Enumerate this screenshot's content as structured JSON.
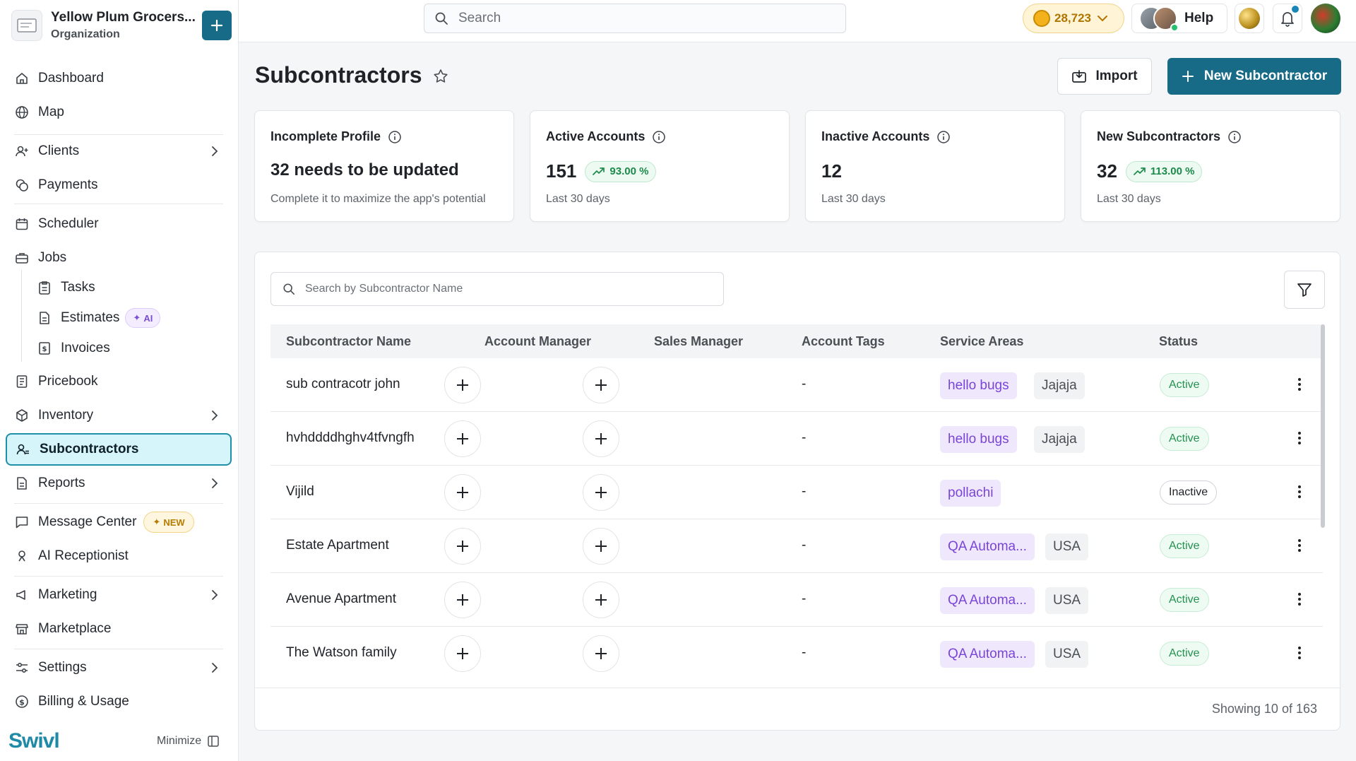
{
  "org": {
    "name": "Yellow Plum Grocers...",
    "subtitle": "Organization"
  },
  "sidebar": {
    "items": [
      {
        "label": "Dashboard"
      },
      {
        "label": "Map"
      },
      {
        "label": "Clients"
      },
      {
        "label": "Payments"
      },
      {
        "label": "Scheduler"
      },
      {
        "label": "Jobs"
      },
      {
        "label": "Tasks"
      },
      {
        "label": "Estimates",
        "badge": "AI"
      },
      {
        "label": "Invoices"
      },
      {
        "label": "Pricebook"
      },
      {
        "label": "Inventory"
      },
      {
        "label": "Subcontractors"
      },
      {
        "label": "Reports"
      },
      {
        "label": "Message Center",
        "badge": "NEW"
      },
      {
        "label": "AI Receptionist"
      },
      {
        "label": "Marketing"
      },
      {
        "label": "Marketplace"
      },
      {
        "label": "Settings"
      },
      {
        "label": "Billing & Usage"
      }
    ],
    "brand": "Swivl",
    "minimize_label": "Minimize"
  },
  "topbar": {
    "search_placeholder": "Search",
    "coins": "28,723",
    "help_label": "Help"
  },
  "page": {
    "title": "Subcontractors",
    "import_label": "Import",
    "new_label": "New Subcontractor"
  },
  "cards": [
    {
      "title": "Incomplete Profile",
      "value": "32 needs to be updated",
      "foot": "Complete it to maximize the app's potential"
    },
    {
      "title": "Active Accounts",
      "value": "151",
      "delta": "93.00 %",
      "foot": "Last 30 days"
    },
    {
      "title": "Inactive Accounts",
      "value": "12",
      "foot": "Last 30 days"
    },
    {
      "title": "New Subcontractors",
      "value": "32",
      "delta": "113.00 %",
      "foot": "Last 30 days"
    }
  ],
  "table": {
    "search_placeholder": "Search by Subcontractor Name",
    "columns": [
      "Subcontractor Name",
      "Account Manager",
      "Sales Manager",
      "Account Tags",
      "Service Areas",
      "Status"
    ],
    "rows": [
      {
        "name": "sub contracotr john",
        "tags": "-",
        "areas": [
          "hello bugs",
          "Jajaja"
        ],
        "status": "Active"
      },
      {
        "name": "hvhddddhghv4tfvngfh",
        "tags": "-",
        "areas": [
          "hello bugs",
          "Jajaja"
        ],
        "status": "Active"
      },
      {
        "name": "Vijild",
        "tags": "-",
        "areas": [
          "pollachi"
        ],
        "status": "Inactive"
      },
      {
        "name": "Estate Apartment",
        "tags": "-",
        "areas": [
          "QA Automa...",
          "USA"
        ],
        "status": "Active"
      },
      {
        "name": "Avenue Apartment",
        "tags": "-",
        "areas": [
          "QA Automa...",
          "USA"
        ],
        "status": "Active"
      },
      {
        "name": "The Watson family",
        "tags": "-",
        "areas": [
          "QA Automa...",
          "USA"
        ],
        "status": "Active"
      }
    ],
    "showing": "Showing 10 of 163"
  },
  "colors": {
    "primary": "#176b87",
    "active_bg": "#d6f5fb",
    "success": "#23914f",
    "chip_purple": "#7a44d8"
  }
}
